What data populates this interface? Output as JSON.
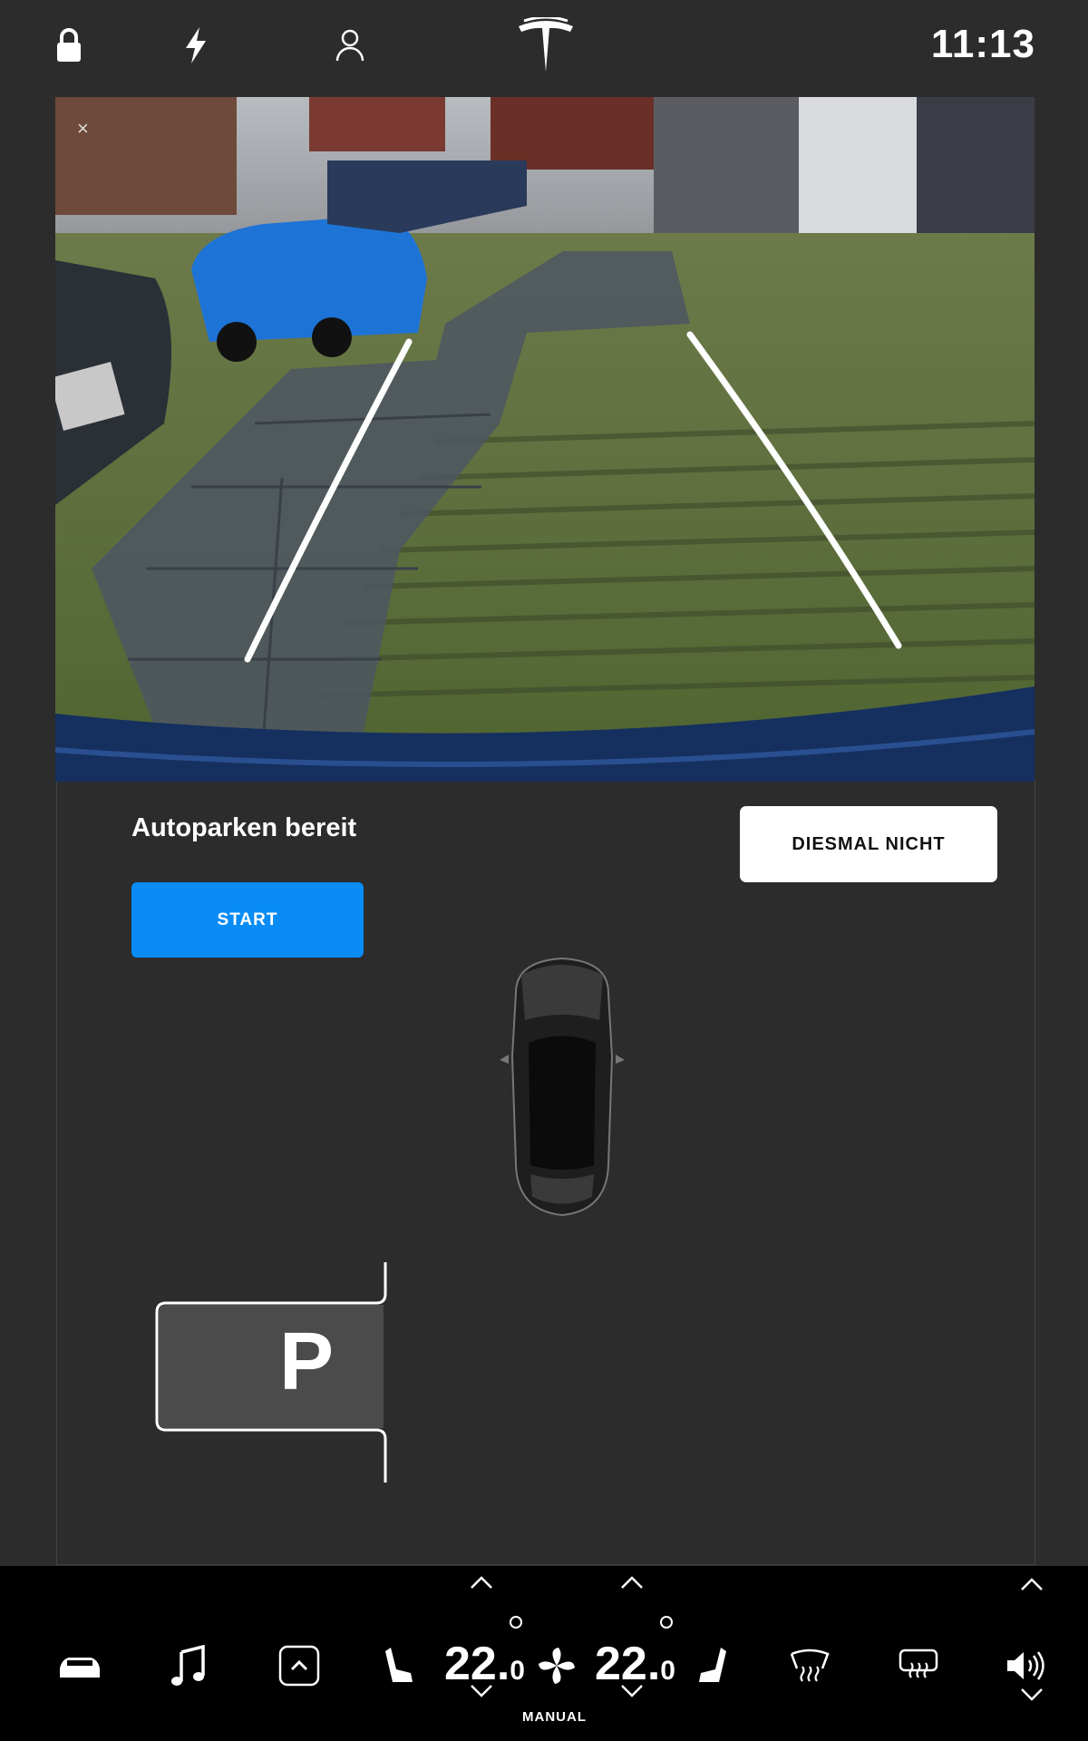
{
  "status_bar": {
    "clock": "11:13",
    "icons": [
      "lock-icon",
      "bolt-icon",
      "profile-icon",
      "tesla-logo"
    ]
  },
  "camera": {
    "view": "rear-camera",
    "close_icon": "close-icon",
    "close_glyph": "×"
  },
  "autopark": {
    "title": "Autoparken bereit",
    "start_label": "START",
    "dismiss_label": "DIESMAL NICHT",
    "spot_label": "P"
  },
  "bottom_bar": {
    "icons": [
      "car-icon",
      "music-icon",
      "apps-icon",
      "seat-heater-left-icon",
      "fan-icon",
      "seat-heater-right-icon",
      "rear-defrost-icon",
      "front-defrost-icon",
      "volume-icon"
    ],
    "left_temp_whole": "22.",
    "left_temp_decimal": "0",
    "right_temp_whole": "22.",
    "right_temp_decimal": "0",
    "climate_mode": "MANUAL"
  },
  "colors": {
    "background": "#2c2c2c",
    "accent": "#0a8cf6",
    "bar": "#000000"
  }
}
